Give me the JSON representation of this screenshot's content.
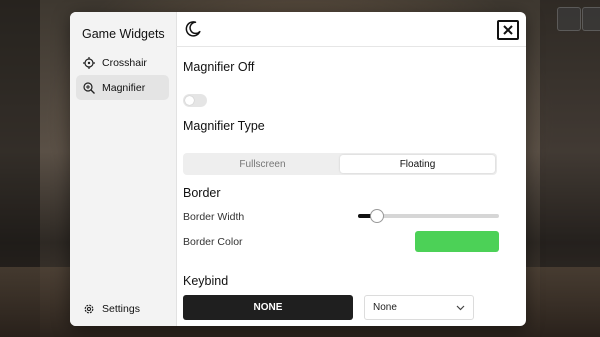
{
  "sidebar": {
    "title": "Game Widgets",
    "items": [
      {
        "label": "Crosshair",
        "icon": "crosshair-icon",
        "active": false
      },
      {
        "label": "Magnifier",
        "icon": "magnifier-icon",
        "active": true
      }
    ],
    "settings_label": "Settings"
  },
  "topbar": {
    "theme_icon": "moon-icon",
    "close_icon": "close-icon"
  },
  "magnifier": {
    "toggle_label": "Magnifier Off",
    "enabled": false,
    "type_heading": "Magnifier Type",
    "type_options": [
      "Fullscreen",
      "Floating"
    ],
    "type_selected": "Floating"
  },
  "border": {
    "heading": "Border",
    "width_label": "Border Width",
    "width_value_fraction": 0.13,
    "color_label": "Border Color",
    "color": "#4cd157"
  },
  "keybind": {
    "heading": "Keybind",
    "key_value": "NONE",
    "modifier_value": "None"
  }
}
